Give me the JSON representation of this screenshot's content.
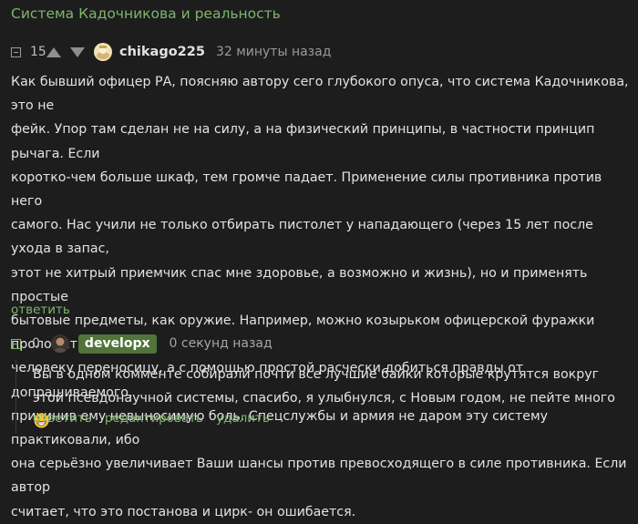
{
  "post": {
    "title": "Система Кадочникова и реальность"
  },
  "comment": {
    "rating": "15",
    "username": "chikago225",
    "time": "32 минуты назад",
    "text": "Как бывший офицер РА, поясняю автору сего глубокого опуса, что система Кадочникова, это не\nфейк. Упор там сделан не на силу, а на физический принципы, в частности принцип рычага. Если\nкоротко-чем больше шкаф, тем громче падает. Применение силы противника против него\nсамого. Нас учили не только отбирать пистолет у нападающего (через 15 лет после ухода в запас,\nэтот не хитрый приемчик спас мне здоровье, а возможно и жизнь), но и применять простые\nбытовые предметы, как оружие. Например, можно козырьком офицерской фуражки проломить\nчеловеку переносицу, а с помощью простой расчески добиться правды от допрашиваемого,\nпричинив ему невыносимую боль. Спецслужбы и армия не даром эту систему практиковали, ибо\nона серьёзно увеличивает Ваши шансы против превосходящего в силе противника. Если автор\nсчитает, что это постанова и цирк- он ошибается.",
    "reply_label": "ответить"
  },
  "reply": {
    "rating": "0",
    "username": "developx",
    "time": "0 секунд назад",
    "text": "Вы в одном комменте собирали почти все лучшие байки которые крутятся вокруг этой псевдонаучной системы, спасибо, я улыбнулся, с Новым годом, не пейте много",
    "actions": {
      "reply": "ответить",
      "edit": "редактировать",
      "delete": "удалить"
    }
  },
  "colors": {
    "background": "#1d1d1e",
    "accent_green": "#7fb56a",
    "badge_green": "#50743a",
    "muted_text": "#9a9a9a"
  },
  "icons": {
    "collapse": "collapse-minus-icon",
    "upvote": "arrow-up-icon",
    "downvote": "arrow-down-icon",
    "emoji": "grinning-face-emoji-icon"
  }
}
